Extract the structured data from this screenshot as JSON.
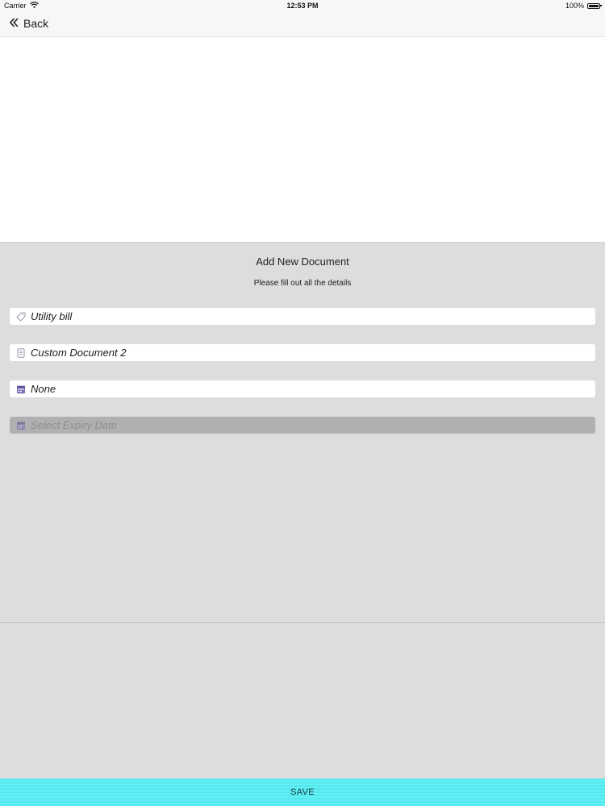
{
  "status_bar": {
    "carrier": "Carrier",
    "time": "12:53 PM",
    "battery": "100%"
  },
  "nav": {
    "back_label": "Back"
  },
  "form": {
    "title": "Add New Document",
    "subtitle": "Please fill out all the details",
    "fields": [
      {
        "value": "Utility bill",
        "icon": "tag-icon"
      },
      {
        "value": "Custom Document 2",
        "icon": "document-icon"
      },
      {
        "value": "None",
        "icon": "calendar-icon"
      },
      {
        "placeholder": "Select Expiry Date",
        "icon": "calendar-icon"
      }
    ]
  },
  "footer": {
    "save_label": "SAVE"
  },
  "colors": {
    "panel_bg": "#dddcde",
    "save_bar": "#52e8ee",
    "icon_accent": "#7b6fb4",
    "disabled_field": "#b0afb1"
  }
}
